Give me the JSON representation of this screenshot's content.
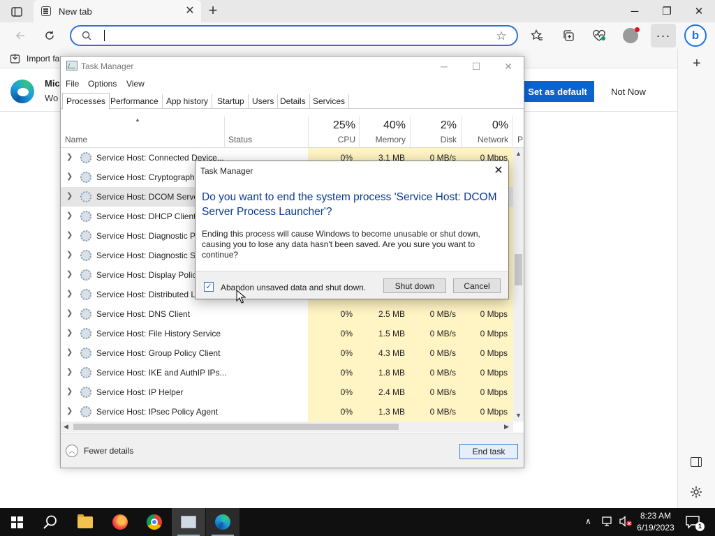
{
  "browser": {
    "tab_title": "New tab",
    "tab_close": "✕",
    "new_tab": "+",
    "win_minimize": "─",
    "win_restore": "❐",
    "win_close": "✕",
    "address_value": "",
    "favorites_import_label": "Import fa",
    "banner_title": "Mic",
    "banner_text": "Wo",
    "set_default_label": "Set as default",
    "not_now_label": "Not Now",
    "more_label": "···",
    "bing_label": "b",
    "sidebar_add": "+"
  },
  "task_manager": {
    "title": "Task Manager",
    "menu": [
      "File",
      "Options",
      "View"
    ],
    "tabs": [
      "Processes",
      "Performance",
      "App history",
      "Startup",
      "Users",
      "Details",
      "Services"
    ],
    "active_tab": "Processes",
    "columns": {
      "name": "Name",
      "status": "Status",
      "cpu": {
        "pct": "25%",
        "label": "CPU"
      },
      "memory": {
        "pct": "40%",
        "label": "Memory"
      },
      "disk": {
        "pct": "2%",
        "label": "Disk"
      },
      "network": {
        "pct": "0%",
        "label": "Network"
      },
      "power_truncated": "P"
    },
    "rows": [
      {
        "name": "Service Host: Connected Device...",
        "cpu": "0%",
        "memory": "3.1 MB",
        "disk": "0 MB/s",
        "network": "0 Mbps"
      },
      {
        "name": "Service Host: Cryptographi",
        "cpu": "",
        "memory": "",
        "disk": "",
        "network": ""
      },
      {
        "name": "Service Host: DCOM Server",
        "cpu": "",
        "memory": "",
        "disk": "",
        "network": ""
      },
      {
        "name": "Service Host: DHCP Client",
        "cpu": "",
        "memory": "",
        "disk": "",
        "network": ""
      },
      {
        "name": "Service Host: Diagnostic Po",
        "cpu": "",
        "memory": "",
        "disk": "",
        "network": ""
      },
      {
        "name": "Service Host: Diagnostic Se",
        "cpu": "",
        "memory": "",
        "disk": "",
        "network": ""
      },
      {
        "name": "Service Host: Display Policy",
        "cpu": "",
        "memory": "",
        "disk": "",
        "network": ""
      },
      {
        "name": "Service Host: Distributed Li",
        "cpu": "",
        "memory": "",
        "disk": "",
        "network": ""
      },
      {
        "name": "Service Host: DNS Client",
        "cpu": "0%",
        "memory": "2.5 MB",
        "disk": "0 MB/s",
        "network": "0 Mbps"
      },
      {
        "name": "Service Host: File History Service",
        "cpu": "0%",
        "memory": "1.5 MB",
        "disk": "0 MB/s",
        "network": "0 Mbps"
      },
      {
        "name": "Service Host: Group Policy Client",
        "cpu": "0%",
        "memory": "4.3 MB",
        "disk": "0 MB/s",
        "network": "0 Mbps"
      },
      {
        "name": "Service Host: IKE and AuthIP IPs...",
        "cpu": "0%",
        "memory": "1.8 MB",
        "disk": "0 MB/s",
        "network": "0 Mbps"
      },
      {
        "name": "Service Host: IP Helper",
        "cpu": "0%",
        "memory": "2.4 MB",
        "disk": "0 MB/s",
        "network": "0 Mbps"
      },
      {
        "name": "Service Host: IPsec Policy Agent",
        "cpu": "0%",
        "memory": "1.3 MB",
        "disk": "0 MB/s",
        "network": "0 Mbps"
      }
    ],
    "selected_row": 2,
    "fewer_details": "Fewer details",
    "end_task": "End task"
  },
  "dialog": {
    "title": "Task Manager",
    "close": "✕",
    "heading": "Do you want to end the system process 'Service Host: DCOM Server Process Launcher'?",
    "body": "Ending this process will cause Windows to become unusable or shut down, causing you to lose any data hasn't been saved. Are you sure you want to continue?",
    "checkbox_label": "Abandon unsaved data and shut down.",
    "checkbox_checked": true,
    "checkmark": "✓",
    "shutdown_label": "Shut down",
    "cancel_label": "Cancel"
  },
  "taskbar": {
    "apps": [
      "start-icon",
      "search-icon",
      "file-explorer-icon",
      "firefox-icon",
      "chrome-icon",
      "task-manager-icon",
      "edge-icon"
    ],
    "time": "8:23 AM",
    "date": "6/19/2023",
    "tray_chevron": "∧",
    "notification_count": "1"
  },
  "colors": {
    "accent": "#0b63ce",
    "dialog_heading": "#0a3a96",
    "heat": "#fff4c4",
    "taskbar": "#101010"
  }
}
